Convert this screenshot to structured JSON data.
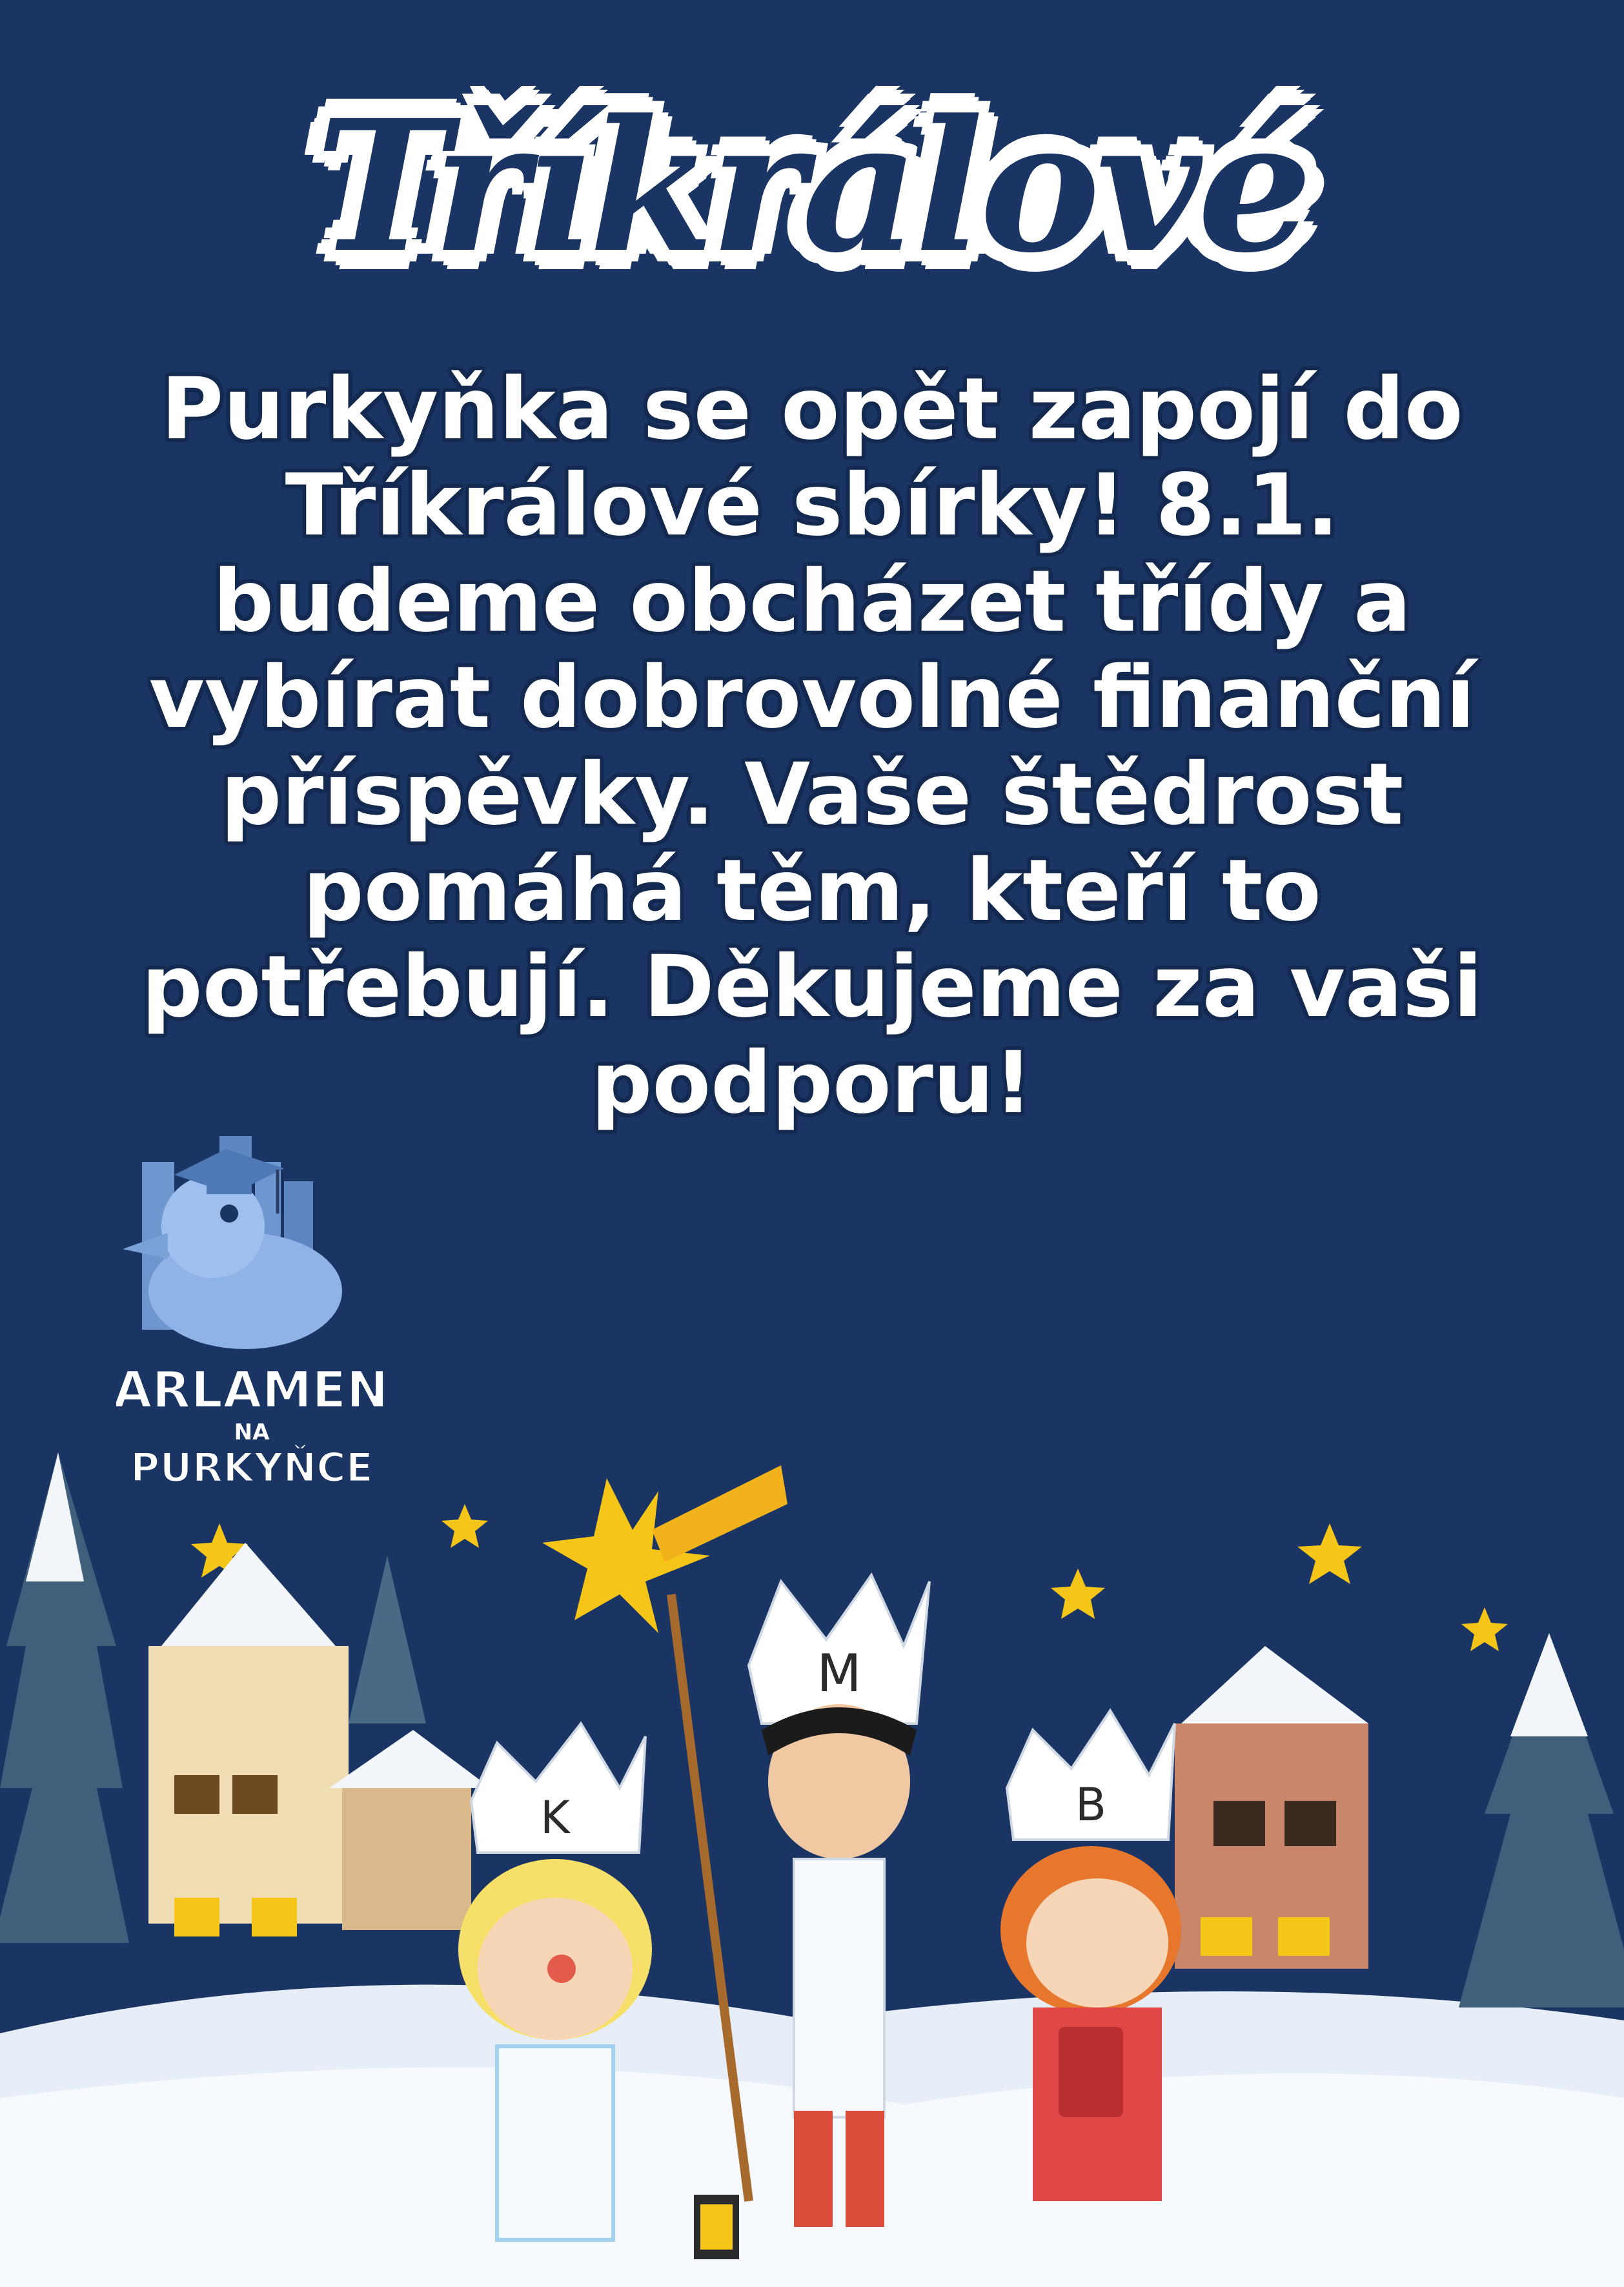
{
  "poster": {
    "title": "Tříkrálové",
    "text_lines": [
      "Purkyňka se opět zapojí do",
      "Tříkrálové sbírky! 8.1.",
      "budeme obcházet třídy a",
      "vybírat dobrovolné finanční",
      "příspěvky. Vaše štědrost",
      "pomáhá těm, kteří to",
      "potřebují. Děkujeme za vaši",
      "podporu!"
    ]
  },
  "logo": {
    "line1": "PARLAMENT",
    "line2": "NA",
    "line3": "PURKYŇCE",
    "icon": "duck-with-graduation-cap-icon"
  },
  "illustration": {
    "crown_letters": [
      "K",
      "M",
      "B"
    ],
    "icons": [
      "shooting-star-icon",
      "star-icon",
      "house-icon",
      "fir-tree-icon",
      "lantern-icon"
    ]
  },
  "colors": {
    "background": "#1a3563",
    "text": "#ffffff",
    "star": "#f5c518",
    "logo": "#7aa2d6"
  }
}
